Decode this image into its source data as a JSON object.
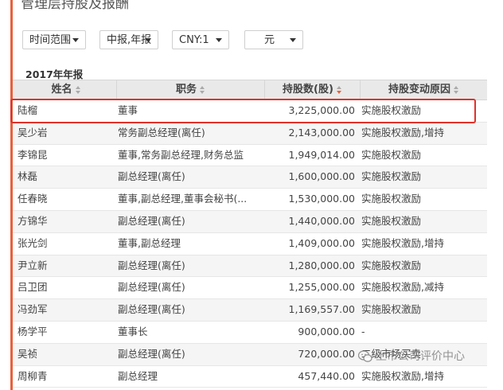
{
  "page": {
    "title": "管理层持股及报酬"
  },
  "filters": {
    "time_range": "时间范围",
    "report_type": "中报,年报",
    "currency": "CNY:1",
    "unit": "元"
  },
  "section": {
    "year_label": "2017年年报"
  },
  "table": {
    "columns": [
      "姓名",
      "职务",
      "持股数(股)",
      "持股变动原因"
    ],
    "rows": [
      {
        "name": "陆榴",
        "position": "董事",
        "shares": "3,225,000.00",
        "reason": "实施股权激励"
      },
      {
        "name": "吴少岩",
        "position": "常务副总经理(离任)",
        "shares": "2,143,000.00",
        "reason": "实施股权激励,增持"
      },
      {
        "name": "李锦昆",
        "position": "董事,常务副总经理,财务总监",
        "shares": "1,949,014.00",
        "reason": "实施股权激励"
      },
      {
        "name": "林磊",
        "position": "副总经理(离任)",
        "shares": "1,600,000.00",
        "reason": "实施股权激励"
      },
      {
        "name": "任春晓",
        "position": "董事,副总经理,董事会秘书(...",
        "shares": "1,530,000.00",
        "reason": "实施股权激励"
      },
      {
        "name": "方锦华",
        "position": "副总经理(离任)",
        "shares": "1,440,000.00",
        "reason": "实施股权激励"
      },
      {
        "name": "张光剑",
        "position": "董事,副总经理",
        "shares": "1,409,000.00",
        "reason": "实施股权激励,增持"
      },
      {
        "name": "尹立新",
        "position": "副总经理(离任)",
        "shares": "1,280,000.00",
        "reason": "实施股权激励"
      },
      {
        "name": "吕卫团",
        "position": "副总经理(离任)",
        "shares": "1,255,000.00",
        "reason": "实施股权激励,减持"
      },
      {
        "name": "冯劲军",
        "position": "副总经理(离任)",
        "shares": "1,169,557.00",
        "reason": "实施股权激励"
      },
      {
        "name": "杨学平",
        "position": "董事长",
        "shares": "900,000.00",
        "reason": "-"
      },
      {
        "name": "吴祯",
        "position": "副总经理(离任)",
        "shares": "720,000.00",
        "reason": "二级市场买卖"
      },
      {
        "name": "周柳青",
        "position": "副总经理",
        "shares": "457,440.00",
        "reason": "实施股权激励,增持"
      }
    ]
  },
  "watermark": {
    "text": "上市公司评价中心",
    "icon": "wechat-icon"
  },
  "colors": {
    "accent": "#e8603c",
    "highlight": "#e0322a",
    "header_bg": "#e9e9e9",
    "alt_row": "#f5f5f5"
  }
}
